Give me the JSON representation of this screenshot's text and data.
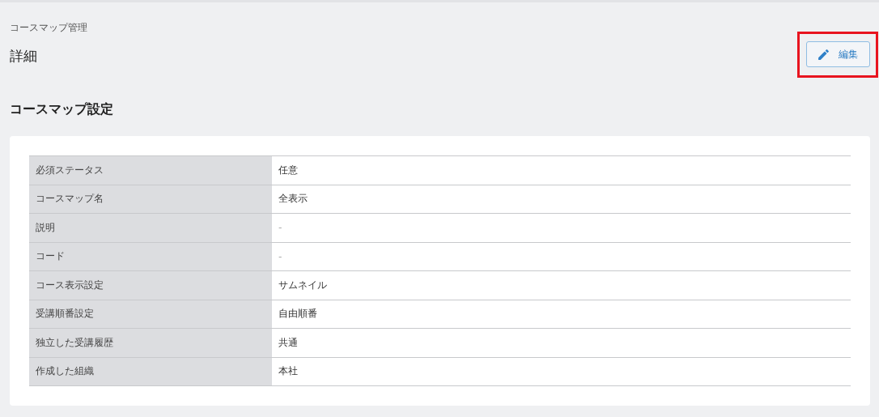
{
  "breadcrumb": "コースマップ管理",
  "title": "詳細",
  "edit_button": {
    "label": "編集",
    "highlighted": true
  },
  "section_title": "コースマップ設定",
  "rows": [
    {
      "label": "必須ステータス",
      "value": "任意",
      "empty": false
    },
    {
      "label": "コースマップ名",
      "value": "全表示",
      "empty": false
    },
    {
      "label": "説明",
      "value": "-",
      "empty": true
    },
    {
      "label": "コード",
      "value": "-",
      "empty": true
    },
    {
      "label": "コース表示設定",
      "value": "サムネイル",
      "empty": false
    },
    {
      "label": "受講順番設定",
      "value": "自由順番",
      "empty": false
    },
    {
      "label": "独立した受講履歴",
      "value": "共通",
      "empty": false
    },
    {
      "label": "作成した組織",
      "value": "本社",
      "empty": false
    }
  ]
}
